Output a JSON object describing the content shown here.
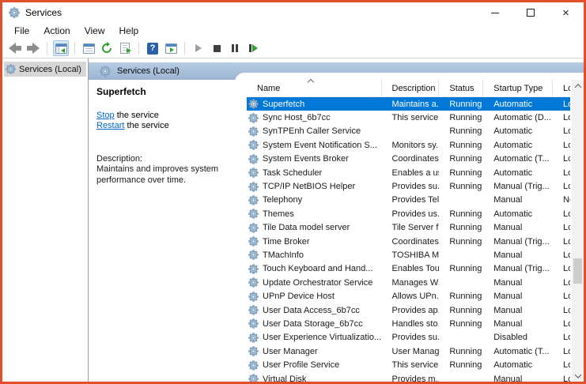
{
  "window": {
    "title": "Services",
    "controls": {
      "minimize": "minimize",
      "maximize": "maximize",
      "close": "close"
    }
  },
  "colors": {
    "capture_border": "#E2502B",
    "selection_blue": "#0078D7",
    "band_blue": "#A7BFD9",
    "link_blue": "#0066CC"
  },
  "menu": {
    "items": [
      "File",
      "Action",
      "View",
      "Help"
    ]
  },
  "toolbar": {
    "items": [
      "back",
      "forward",
      "show-console-tree",
      "properties",
      "refresh",
      "export-list",
      "help",
      "show-action-pane",
      "start-service",
      "stop-service",
      "pause-service",
      "restart-service"
    ]
  },
  "tree": {
    "selected_item": "Services (Local)"
  },
  "band": {
    "title": "Services (Local)"
  },
  "detail": {
    "service_name": "Superfetch",
    "stop_link": "Stop",
    "stop_rest": " the service",
    "restart_link": "Restart",
    "restart_rest": " the service",
    "description_label": "Description:",
    "description_text": "Maintains and improves system performance over time."
  },
  "list": {
    "columns": [
      "Name",
      "Description",
      "Status",
      "Startup Type",
      "Log"
    ],
    "sort_column": "Name",
    "sort_direction": "ascending",
    "rows": [
      {
        "name": "Superfetch",
        "description": "Maintains a...",
        "status": "Running",
        "startup": "Automatic",
        "log": "Loc",
        "selected": true
      },
      {
        "name": "Sync Host_6b7cc",
        "description": "This service ...",
        "status": "Running",
        "startup": "Automatic (D...",
        "log": "Loc",
        "selected": false
      },
      {
        "name": "SynTPEnh Caller Service",
        "description": "",
        "status": "Running",
        "startup": "Automatic",
        "log": "Loc",
        "selected": false
      },
      {
        "name": "System Event Notification S...",
        "description": "Monitors sy...",
        "status": "Running",
        "startup": "Automatic",
        "log": "Loc",
        "selected": false
      },
      {
        "name": "System Events Broker",
        "description": "Coordinates...",
        "status": "Running",
        "startup": "Automatic (T...",
        "log": "Loc",
        "selected": false
      },
      {
        "name": "Task Scheduler",
        "description": "Enables a us...",
        "status": "Running",
        "startup": "Automatic",
        "log": "Loc",
        "selected": false
      },
      {
        "name": "TCP/IP NetBIOS Helper",
        "description": "Provides su...",
        "status": "Running",
        "startup": "Manual (Trig...",
        "log": "Loc",
        "selected": false
      },
      {
        "name": "Telephony",
        "description": "Provides Tel...",
        "status": "",
        "startup": "Manual",
        "log": "Net",
        "selected": false
      },
      {
        "name": "Themes",
        "description": "Provides us...",
        "status": "Running",
        "startup": "Automatic",
        "log": "Loc",
        "selected": false
      },
      {
        "name": "Tile Data model server",
        "description": "Tile Server f...",
        "status": "Running",
        "startup": "Manual",
        "log": "Loc",
        "selected": false
      },
      {
        "name": "Time Broker",
        "description": "Coordinates...",
        "status": "Running",
        "startup": "Manual (Trig...",
        "log": "Loc",
        "selected": false
      },
      {
        "name": "TMachInfo",
        "description": "TOSHIBA M...",
        "status": "",
        "startup": "Manual",
        "log": "Loc",
        "selected": false
      },
      {
        "name": "Touch Keyboard and Hand...",
        "description": "Enables Tou...",
        "status": "Running",
        "startup": "Manual (Trig...",
        "log": "Loc",
        "selected": false
      },
      {
        "name": "Update Orchestrator Service",
        "description": "Manages W...",
        "status": "",
        "startup": "Manual",
        "log": "Loc",
        "selected": false
      },
      {
        "name": "UPnP Device Host",
        "description": "Allows UPn...",
        "status": "Running",
        "startup": "Manual",
        "log": "Loc",
        "selected": false
      },
      {
        "name": "User Data Access_6b7cc",
        "description": "Provides ap...",
        "status": "Running",
        "startup": "Manual",
        "log": "Loc",
        "selected": false
      },
      {
        "name": "User Data Storage_6b7cc",
        "description": "Handles sto...",
        "status": "Running",
        "startup": "Manual",
        "log": "Loc",
        "selected": false
      },
      {
        "name": "User Experience Virtualizatio...",
        "description": "Provides su...",
        "status": "",
        "startup": "Disabled",
        "log": "Loc",
        "selected": false
      },
      {
        "name": "User Manager",
        "description": "User Manag...",
        "status": "Running",
        "startup": "Automatic (T...",
        "log": "Loc",
        "selected": false
      },
      {
        "name": "User Profile Service",
        "description": "This service ...",
        "status": "Running",
        "startup": "Automatic",
        "log": "Loc",
        "selected": false
      },
      {
        "name": "Virtual Disk",
        "description": "Provides m...",
        "status": "",
        "startup": "Manual",
        "log": "Loc",
        "selected": false
      }
    ]
  }
}
